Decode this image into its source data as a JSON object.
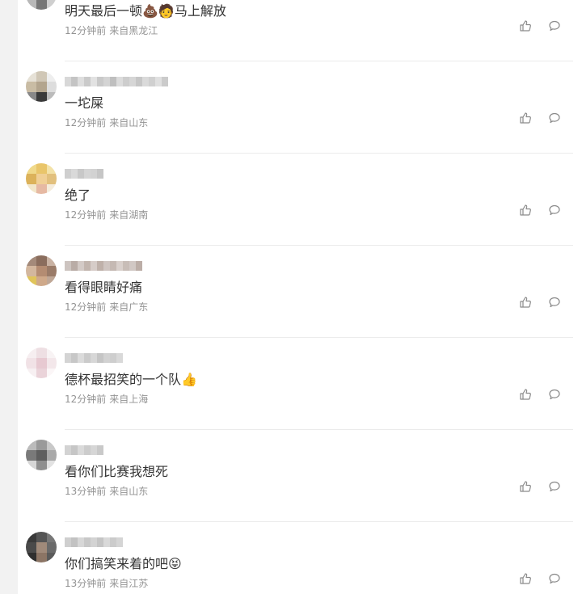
{
  "comments": [
    {
      "text": "明天最后一顿💩🧑马上解放",
      "time": "12分钟前",
      "from": "来自黑龙江"
    },
    {
      "text": "一坨屎",
      "time": "12分钟前",
      "from": "来自山东"
    },
    {
      "text": "绝了",
      "time": "12分钟前",
      "from": "来自湖南"
    },
    {
      "text": "看得眼睛好痛",
      "time": "12分钟前",
      "from": "来自广东"
    },
    {
      "text": "德杯最招笑的一个队👍",
      "time": "12分钟前",
      "from": "来自上海"
    },
    {
      "text": "看你们比赛我想死",
      "time": "13分钟前",
      "from": "来自山东"
    },
    {
      "text": "你们搞笑来着的吧😝",
      "time": "13分钟前",
      "from": "来自江苏"
    }
  ],
  "icons": {
    "like": "thumbs-up-icon",
    "reply": "comment-bubble-icon"
  },
  "colors": {
    "text": "#333333",
    "meta": "#939393",
    "icon": "#8a8a8a",
    "divider": "#ebebeb"
  }
}
